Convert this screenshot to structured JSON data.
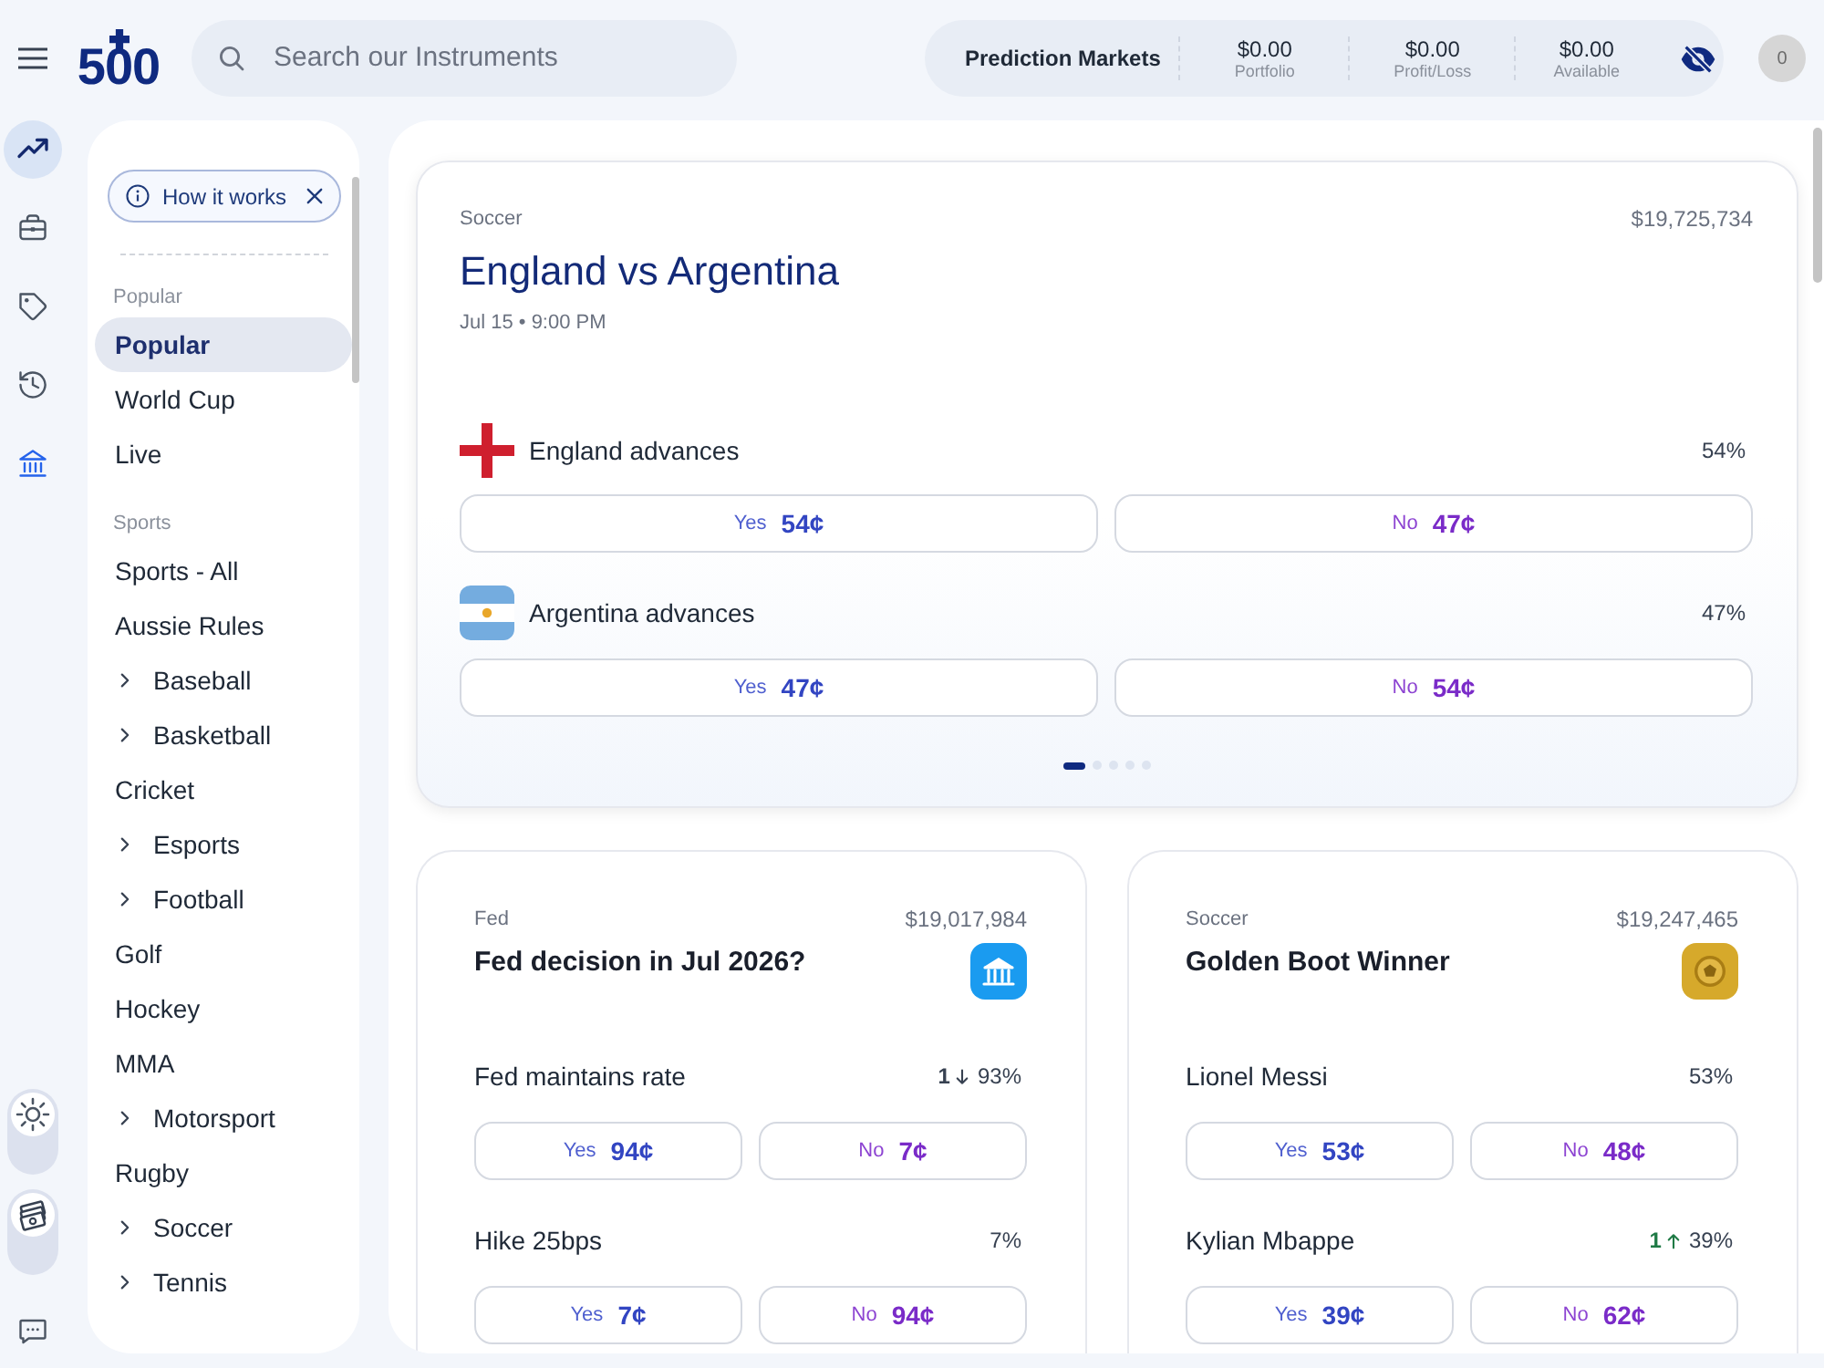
{
  "header": {
    "logo": {
      "text": "500"
    },
    "search": {
      "placeholder": "Search our Instruments"
    },
    "account": {
      "title": "Prediction Markets",
      "stats": [
        {
          "value": "$0.00",
          "label": "Portfolio"
        },
        {
          "value": "$0.00",
          "label": "Profit/Loss"
        },
        {
          "value": "$0.00",
          "label": "Available"
        }
      ]
    },
    "avatar": {
      "text": "0"
    }
  },
  "rail": {
    "items": [
      {
        "kind": "trending",
        "selected": true,
        "highlighted": false
      },
      {
        "kind": "portfolio",
        "selected": false,
        "highlighted": false
      },
      {
        "kind": "offers",
        "selected": false,
        "highlighted": false
      },
      {
        "kind": "history",
        "selected": false,
        "highlighted": false
      },
      {
        "kind": "bank",
        "selected": false,
        "highlighted": true
      }
    ],
    "toggles": [
      {
        "kind": "theme",
        "on": false
      },
      {
        "kind": "cash",
        "on": false
      }
    ]
  },
  "sidebar": {
    "how_it_works": "How it works",
    "sections": [
      {
        "title": "Popular",
        "items": [
          {
            "label": "Popular",
            "kind": "link",
            "selected": true
          },
          {
            "label": "World Cup",
            "kind": "link",
            "selected": false
          },
          {
            "label": "Live",
            "kind": "link",
            "selected": false
          }
        ]
      },
      {
        "title": "Sports",
        "items": [
          {
            "label": "Sports - All",
            "kind": "link",
            "selected": false
          },
          {
            "label": "Aussie Rules",
            "kind": "link",
            "selected": false
          },
          {
            "label": "Baseball",
            "kind": "group",
            "selected": false,
            "expanded": false
          },
          {
            "label": "Basketball",
            "kind": "group",
            "selected": false,
            "expanded": false
          },
          {
            "label": "Cricket",
            "kind": "link",
            "selected": false
          },
          {
            "label": "Esports",
            "kind": "group",
            "selected": false,
            "expanded": false
          },
          {
            "label": "Football",
            "kind": "group",
            "selected": false,
            "expanded": false
          },
          {
            "label": "Golf",
            "kind": "link",
            "selected": false
          },
          {
            "label": "Hockey",
            "kind": "link",
            "selected": false
          },
          {
            "label": "MMA",
            "kind": "link",
            "selected": false
          },
          {
            "label": "Motorsport",
            "kind": "group",
            "selected": false,
            "expanded": false
          },
          {
            "label": "Rugby",
            "kind": "link",
            "selected": false
          },
          {
            "label": "Soccer",
            "kind": "group",
            "selected": false,
            "expanded": false
          },
          {
            "label": "Tennis",
            "kind": "group",
            "selected": false,
            "expanded": false
          }
        ]
      }
    ]
  },
  "featured": {
    "category": "Soccer",
    "volume": "$19,725,734",
    "title": "England vs Argentina",
    "time": "Jul 15 • 9:00 PM",
    "outcomes": [
      {
        "kind": "england",
        "label": "England advances",
        "percent": "54%",
        "yes": {
          "label": "Yes",
          "price": "54¢"
        },
        "no": {
          "label": "No",
          "price": "47¢"
        }
      },
      {
        "kind": "argentina",
        "label": "Argentina advances",
        "percent": "47%",
        "yes": {
          "label": "Yes",
          "price": "47¢"
        },
        "no": {
          "label": "No",
          "price": "54¢"
        }
      }
    ],
    "pager": [
      {
        "selected": true
      },
      {
        "selected": false
      },
      {
        "selected": false
      },
      {
        "selected": false
      },
      {
        "selected": false
      }
    ]
  },
  "markets": [
    {
      "kind": "finance",
      "category": "Fed",
      "volume": "$19,017,984",
      "title": "Fed decision in Jul 2026?",
      "outcomes": [
        {
          "label": "Fed maintains rate",
          "change": "1",
          "rising": false,
          "percent": "93%",
          "yes": {
            "label": "Yes",
            "price": "94¢"
          },
          "no": {
            "label": "No",
            "price": "7¢"
          }
        },
        {
          "label": "Hike 25bps",
          "percent": "7%",
          "yes": {
            "label": "Yes",
            "price": "7¢"
          },
          "no": {
            "label": "No",
            "price": "94¢"
          }
        }
      ]
    },
    {
      "kind": "sports",
      "category": "Soccer",
      "volume": "$19,247,465",
      "title": "Golden Boot Winner",
      "outcomes": [
        {
          "label": "Lionel Messi",
          "percent": "53%",
          "yes": {
            "label": "Yes",
            "price": "53¢"
          },
          "no": {
            "label": "No",
            "price": "48¢"
          }
        },
        {
          "label": "Kylian Mbappe",
          "change": "1",
          "rising": true,
          "percent": "39%",
          "yes": {
            "label": "Yes",
            "price": "39¢"
          },
          "no": {
            "label": "No",
            "price": "62¢"
          }
        }
      ]
    }
  ]
}
